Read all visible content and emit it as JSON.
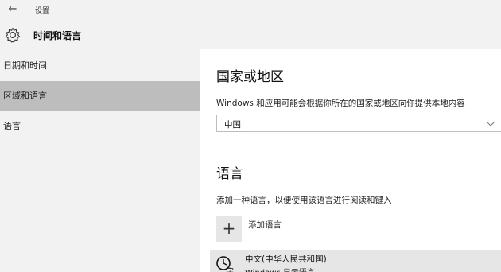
{
  "window": {
    "title": "设置",
    "back_glyph": "←"
  },
  "header": {
    "title": "时间和语言",
    "icon": "gear-icon"
  },
  "sidebar": {
    "items": [
      {
        "label": "日期和时间",
        "selected": false
      },
      {
        "label": "区域和语言",
        "selected": true
      },
      {
        "label": "语言",
        "selected": false
      }
    ]
  },
  "region": {
    "title": "国家或地区",
    "description": "Windows 和应用可能会根据你所在的国家或地区向你提供本地内容",
    "selected": "中国"
  },
  "language": {
    "title": "语言",
    "description": "添加一种语言，以便使用该语言进行阅读和键入",
    "add_label": "添加语言",
    "add_glyph": "+",
    "items": [
      {
        "name": "中文(中华人民共和国)",
        "subtitle": "Windows 显示语言"
      }
    ]
  },
  "colors": {
    "sidebar_bg": "#f2f2f2",
    "selected_bg": "#bdbdbd",
    "tile_bg": "#e6e6e6"
  }
}
